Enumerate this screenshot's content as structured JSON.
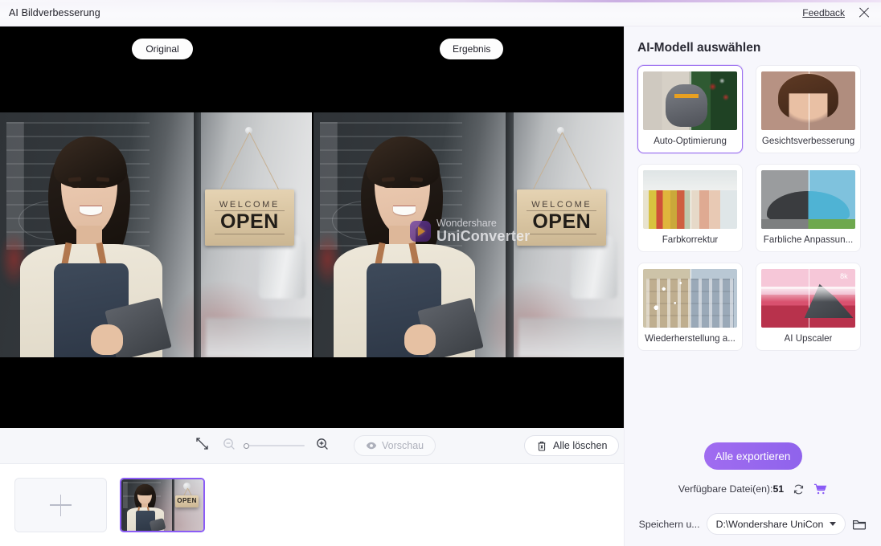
{
  "window": {
    "title": "AI Bildverbesserung",
    "feedback_label": "Feedback",
    "close_icon": "close-icon"
  },
  "preview": {
    "original_badge": "Original",
    "result_badge": "Ergebnis",
    "watermark_line1": "Wondershare",
    "watermark_line2": "UniConverter",
    "photo_sign_welcome": "WELCOME",
    "photo_sign_open": "OPEN"
  },
  "toolbar": {
    "fit_icon": "fit-to-screen-icon",
    "zoom_out_icon": "zoom-out-icon",
    "zoom_in_icon": "zoom-in-icon",
    "zoom_value": 0,
    "preview_label": "Vorschau",
    "preview_icon": "eye-icon",
    "clear_all_label": "Alle löschen",
    "clear_all_icon": "trash-icon"
  },
  "filmstrip": {
    "add_icon": "plus-icon",
    "items": [
      {
        "name": "thumbnail-1",
        "selected": true
      }
    ]
  },
  "panel": {
    "title": "AI-Modell auswählen",
    "models": [
      {
        "label": "Auto-Optimierung",
        "selected": true,
        "thumb": "cat-christmas"
      },
      {
        "label": "Gesichtsverbesserung",
        "selected": false,
        "thumb": "portrait-woman"
      },
      {
        "label": "Farbkorrektur",
        "selected": false,
        "thumb": "colorful-houses"
      },
      {
        "label": "Farbliche Anpassun...",
        "selected": false,
        "thumb": "vintage-car"
      },
      {
        "label": "Wiederherstellung a...",
        "selected": false,
        "thumb": "old-buildings"
      },
      {
        "label": "AI Upscaler",
        "selected": false,
        "thumb": "mountain-lake",
        "badge": "8k"
      }
    ]
  },
  "export": {
    "export_all_label": "Alle exportieren",
    "available_files_label": "Verfügbare Datei(en):",
    "available_files_count": "51",
    "refresh_icon": "refresh-icon",
    "cart_icon": "cart-icon",
    "save_to_label": "Speichern u...",
    "save_path": "D:\\Wondershare UniCon",
    "dropdown_icon": "chevron-down-icon",
    "folder_icon": "folder-icon"
  },
  "colors": {
    "accent": "#8b5cf6",
    "accent_button": "#9b6ff0",
    "panel_bg": "#f7f7fc",
    "toolbar_bg": "#f6f7fa",
    "stage_bg": "#000000"
  }
}
